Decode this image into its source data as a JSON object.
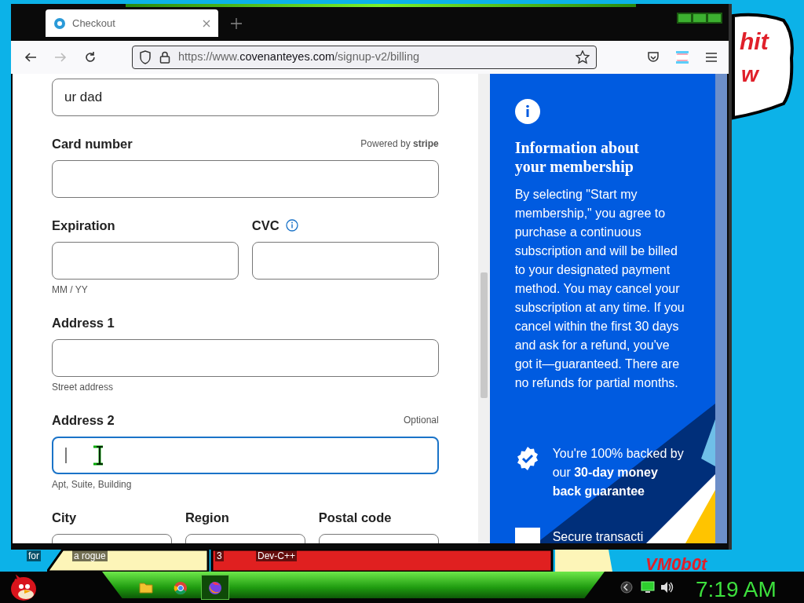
{
  "desktop": {
    "icon_labels": [
      "for",
      "a rogue",
      "3",
      "Dev-C++"
    ],
    "wallpaper_texts": [
      "hit",
      "w",
      "VM0b0t"
    ]
  },
  "browser": {
    "tabs": [
      {
        "title": "Checkout",
        "selected": true
      }
    ],
    "url": {
      "prefix": "https://www.",
      "domain": "covenanteyes.com",
      "path": "/signup-v2/billing"
    }
  },
  "form": {
    "rows": [
      {
        "fields": [
          {
            "value": "ur dad",
            "focused": false
          }
        ]
      },
      {
        "fields": [
          {
            "label": "Card number",
            "aside": "Powered by **stripe**",
            "focused": false
          }
        ]
      },
      {
        "fields": [
          {
            "label": "Expiration",
            "hint": "MM / YY",
            "focused": false
          },
          {
            "label": "CVC",
            "info_icon": true,
            "focused": false
          }
        ]
      },
      {
        "fields": [
          {
            "label": "Address 1",
            "hint": "Street address",
            "focused": false
          }
        ]
      },
      {
        "fields": [
          {
            "label": "Address 2",
            "aside": "Optional",
            "hint": "Apt, Suite, Building",
            "focused": true
          }
        ]
      },
      {
        "fields": [
          {
            "label": "City",
            "focused": false
          },
          {
            "label": "Region",
            "focused": false
          },
          {
            "label": "Postal code",
            "focused": false
          }
        ]
      }
    ]
  },
  "panel": {
    "title": "Information about your membership",
    "body": "By selecting \"Start my membership,\" you agree to purchase a continuous subscription and will be billed to your designated payment method. You may cancel your subscription at any time. If you cancel within the first 30 days and ask for a refund, you've got it—guaranteed. There are no refunds for partial months.",
    "guarantee": "You're 100% backed by our **30-day money back guarantee**",
    "next_item": "Secure transacti"
  },
  "taskbar": {
    "apps": [
      {
        "kind": "folder",
        "selected": false
      },
      {
        "kind": "round",
        "selected": false
      },
      {
        "kind": "fox",
        "selected": true
      }
    ],
    "clock": "7:19 AM"
  }
}
